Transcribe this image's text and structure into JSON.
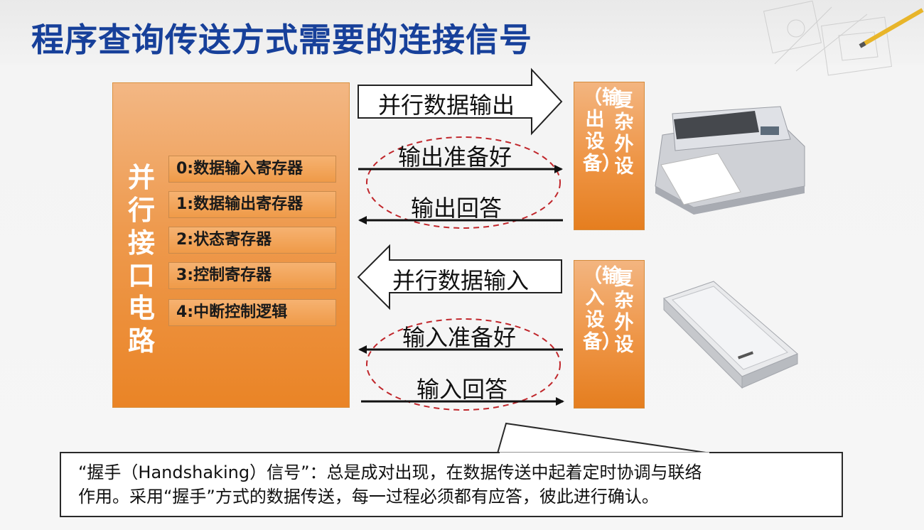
{
  "title": "程序查询传送方式需要的连接信号",
  "interface": {
    "label": "并行接口电路",
    "registers": [
      "0:数据输入寄存器",
      "1:数据输出寄存器",
      "2:状态寄存器",
      "3:控制寄存器",
      "4:中断控制逻辑"
    ]
  },
  "output_device": {
    "main": "复杂外设",
    "sub": "（输出设备）",
    "image": "printer"
  },
  "input_device": {
    "main": "复杂外设",
    "sub": "（输入设备）",
    "image": "scanner"
  },
  "signals": {
    "parallel_out": "并行数据输出",
    "out_ready": "输出准备好",
    "out_ack": "输出回答",
    "parallel_in": "并行数据输入",
    "in_ready": "输入准备好",
    "in_ack": "输入回答"
  },
  "note": {
    "line1": "“握手（Handshaking）信号”：总是成对出现，在数据传送中起着定时协调与联络",
    "line2": "作用。采用“握手”方式的数据传送，每一过程必须都有应答，彼此进行确认。"
  },
  "colors": {
    "title": "#17409a",
    "accent": "#ee9444",
    "ellipse": "#c0262b"
  }
}
